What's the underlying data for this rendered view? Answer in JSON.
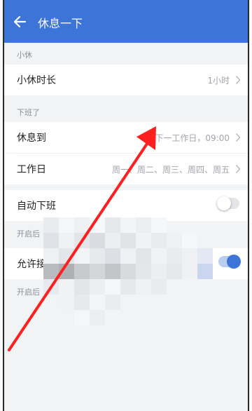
{
  "header": {
    "back_icon": "arrow-left-icon",
    "title": "休息一下",
    "color": "#3d74d8"
  },
  "sections": {
    "break": {
      "label": "小休",
      "duration_label": "小休时长",
      "duration_value": "1小时"
    },
    "off_work": {
      "label": "下班了",
      "rest_until_label": "休息到",
      "rest_until_value": "下一工作日，09:00",
      "workdays_label": "工作日",
      "workdays_value": "周一、周二、周三、周四、周五"
    },
    "auto_off": {
      "label": "自动下班",
      "enabled": false,
      "hint": "开启后"
    },
    "allow": {
      "label": "允许接",
      "enabled": true,
      "hint": "开启后"
    }
  },
  "annotation": {
    "arrow_color": "#ff1f1f"
  }
}
